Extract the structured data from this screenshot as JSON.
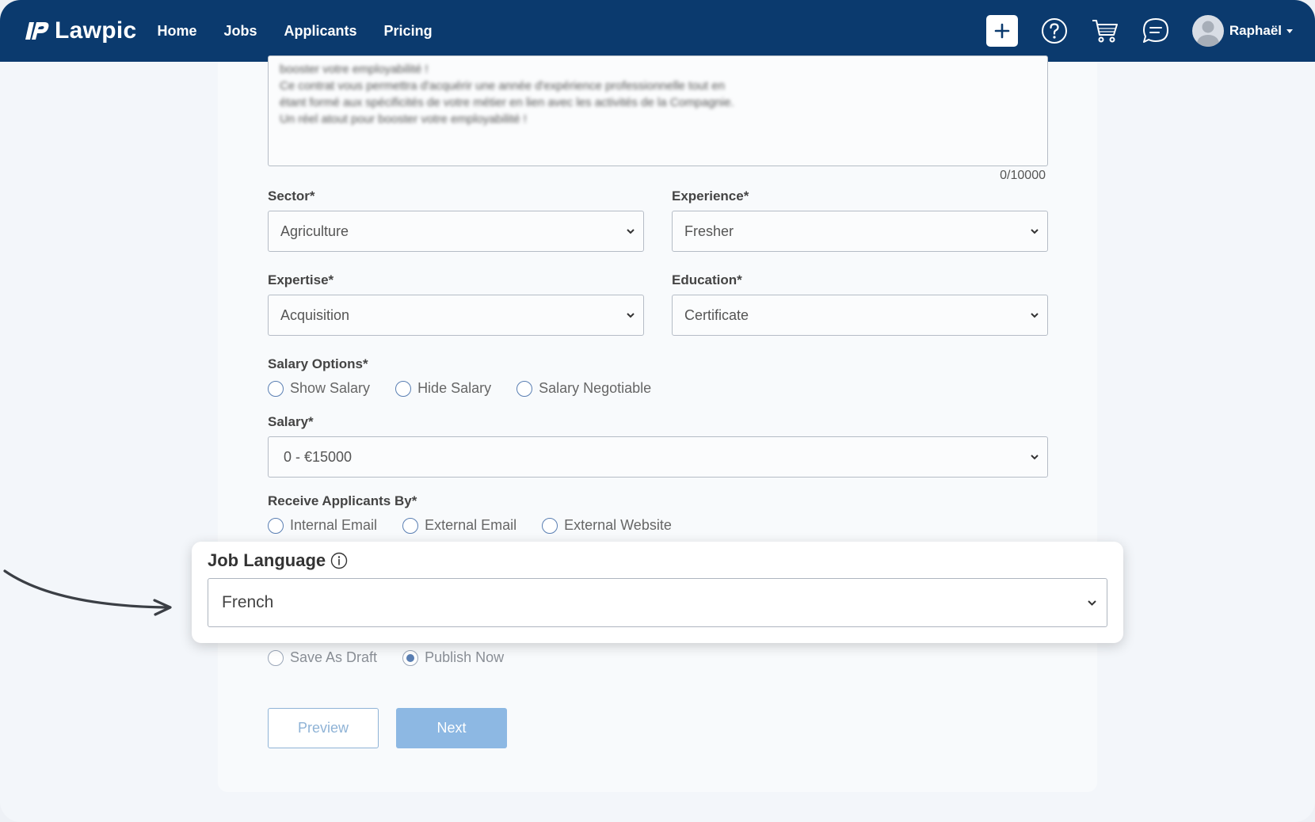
{
  "nav": {
    "brand": "Lawpic",
    "links": [
      "Home",
      "Jobs",
      "Applicants",
      "Pricing"
    ],
    "user_name": "Raphaël"
  },
  "description": {
    "lines": [
      "booster votre employabilité !",
      "Ce contrat vous permettra d'acquérir une année d'expérience professionnelle tout en",
      "étant formé aux spécificités de votre métier en lien avec les activités de la Compagnie.",
      "Un réel atout pour booster votre employabilité !"
    ],
    "counter": "0/10000"
  },
  "form": {
    "sector": {
      "label": "Sector*",
      "value": "Agriculture"
    },
    "experience": {
      "label": "Experience*",
      "value": "Fresher"
    },
    "expertise": {
      "label": "Expertise*",
      "value": "Acquisition"
    },
    "education": {
      "label": "Education*",
      "value": "Certificate"
    },
    "salary_options": {
      "label": "Salary Options*",
      "options": [
        "Show Salary",
        "Hide Salary",
        "Salary Negotiable"
      ]
    },
    "salary": {
      "label": "Salary*",
      "value": "0 - €15000"
    },
    "receive_by": {
      "label": "Receive Applicants By*",
      "options": [
        "Internal Email",
        "External Email",
        "External Website"
      ]
    },
    "job_language": {
      "label": "Job Language",
      "value": "French"
    },
    "publish": {
      "options": [
        "Save As Draft",
        "Publish Now"
      ],
      "selected": "Publish Now"
    }
  },
  "buttons": {
    "preview": "Preview",
    "next": "Next"
  },
  "colors": {
    "navbar": "#0b3a6e",
    "accent": "#5a7fb3",
    "next_button": "#8db8e3"
  }
}
